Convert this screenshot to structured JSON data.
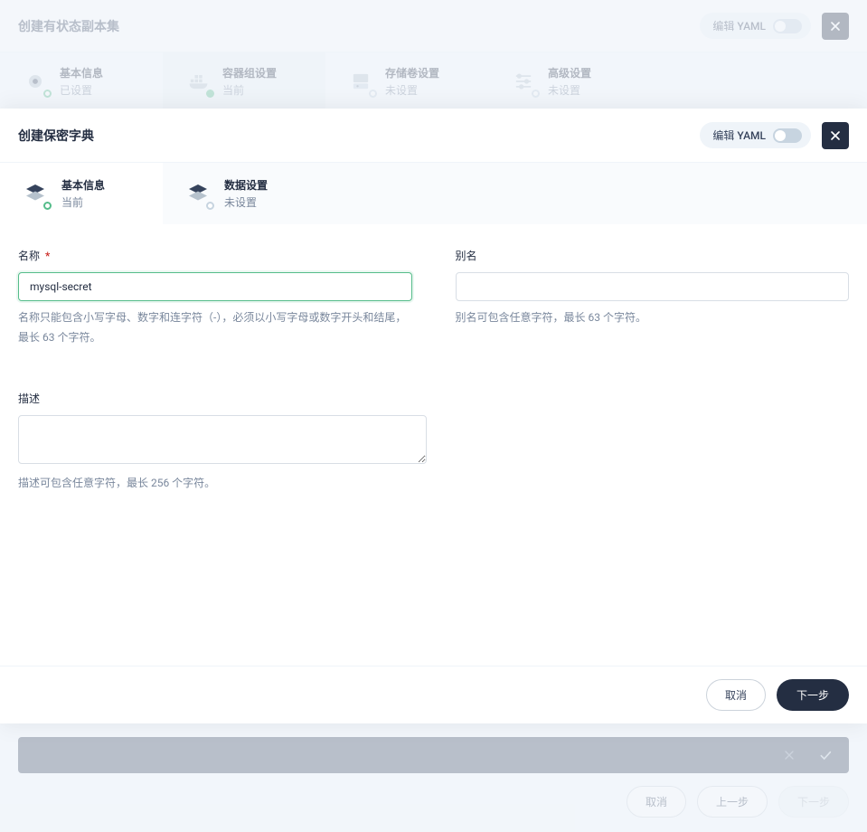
{
  "bg": {
    "title": "创建有状态副本集",
    "yaml_label": "编辑 YAML",
    "tabs": [
      {
        "label": "基本信息",
        "status": "已设置"
      },
      {
        "label": "容器组设置",
        "status": "当前"
      },
      {
        "label": "存储卷设置",
        "status": "未设置"
      },
      {
        "label": "高级设置",
        "status": "未设置"
      }
    ],
    "footer": {
      "cancel": "取消",
      "prev": "上一步",
      "next": "下一步"
    }
  },
  "fg": {
    "title": "创建保密字典",
    "yaml_label": "编辑 YAML",
    "tabs": [
      {
        "label": "基本信息",
        "status": "当前"
      },
      {
        "label": "数据设置",
        "status": "未设置"
      }
    ],
    "fields": {
      "name_label": "名称",
      "name_value": "mysql-secret",
      "name_help": "名称只能包含小写字母、数字和连字符（-），必须以小写字母或数字开头和结尾，最长 63 个字符。",
      "alias_label": "别名",
      "alias_value": "",
      "alias_help": "别名可包含任意字符，最长 63 个字符。",
      "desc_label": "描述",
      "desc_value": "",
      "desc_help": "描述可包含任意字符，最长 256 个字符。"
    },
    "footer": {
      "cancel": "取消",
      "next": "下一步"
    }
  }
}
